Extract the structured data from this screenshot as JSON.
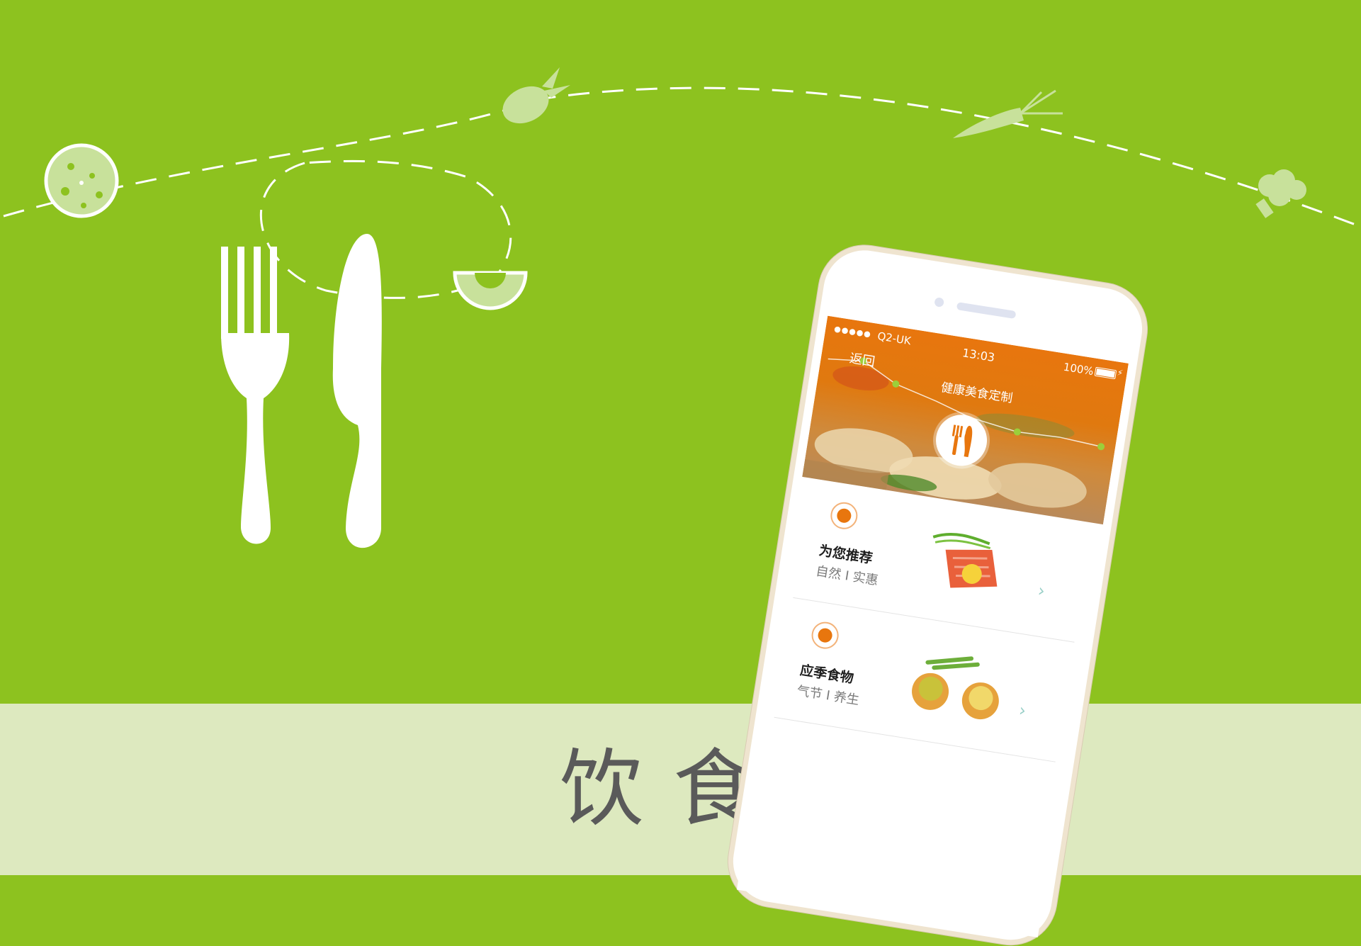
{
  "colors": {
    "background_green": "#8dc21f",
    "band_light": "#dde9bf",
    "accent_orange": "#e8760e",
    "title_gray": "#5a5a5a"
  },
  "hero": {
    "title": "饮食"
  },
  "decorations": {
    "icons": [
      "bread-icon",
      "radish-icon",
      "carrot-icon",
      "broccoli-icon",
      "fork-icon",
      "knife-icon",
      "orange-slice-icon"
    ]
  },
  "app": {
    "status_bar": {
      "signal": "●●●●●",
      "carrier": "Q2-UK",
      "time": "13:03",
      "battery": "100%"
    },
    "nav": {
      "back_label": "返回",
      "title": "健康美食定制"
    },
    "sections": [
      {
        "title": "为您推荐",
        "subtitle": "自然 I 实惠",
        "chevron": "›",
        "icon": "recommend-icon"
      },
      {
        "title": "应季食物",
        "subtitle": "气节 I 养生",
        "chevron": "›",
        "icon": "seasonal-icon"
      }
    ]
  }
}
